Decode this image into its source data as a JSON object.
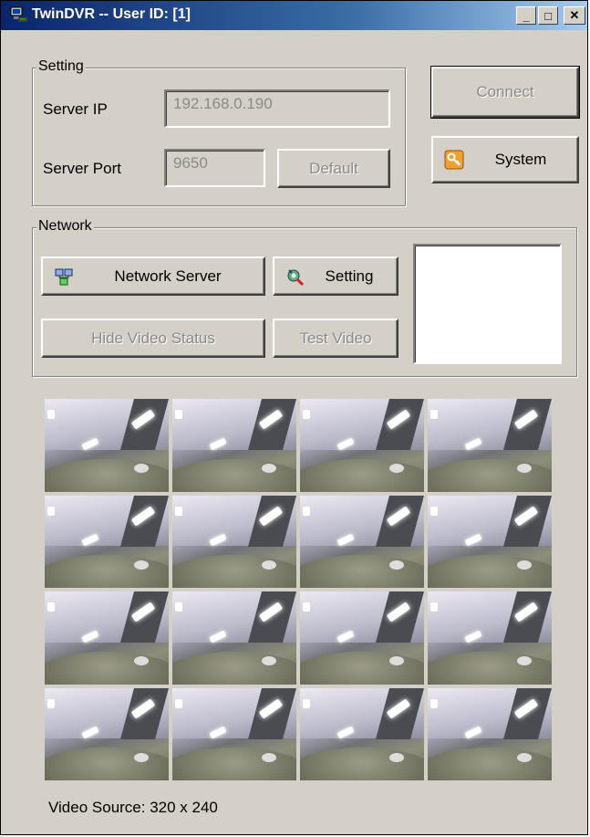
{
  "window": {
    "title": "TwinDVR -- User ID: [1]"
  },
  "titlebar_buttons": {
    "minimize": "_",
    "maximize": "□",
    "close": "✕"
  },
  "setting_group": {
    "label": "Setting",
    "server_ip_label": "Server IP",
    "server_ip_value": "192.168.0.190",
    "server_port_label": "Server Port",
    "server_port_value": "9650",
    "default_button": "Default"
  },
  "side_buttons": {
    "connect": "Connect",
    "system": "System"
  },
  "network_group": {
    "label": "Network",
    "network_server_button": "Network Server",
    "setting_button": "Setting",
    "hide_video_status_button": "Hide Video Status",
    "test_video_button": "Test Video"
  },
  "video_grid": {
    "rows": 4,
    "columns": 4
  },
  "status": {
    "video_source": "Video Source: 320 x 240"
  },
  "icons": {
    "app": "computer-network-icon",
    "system": "key-icon",
    "network_server": "network-server-icon",
    "setting": "gear-wrench-icon"
  }
}
